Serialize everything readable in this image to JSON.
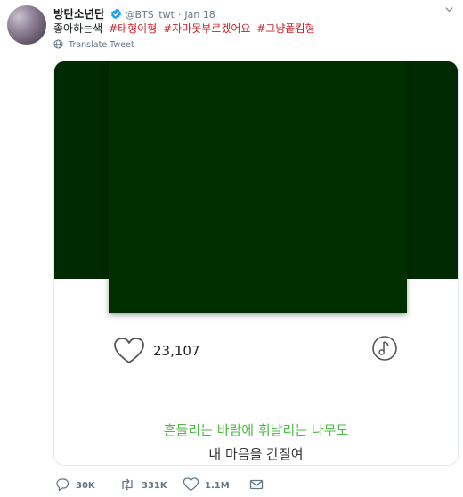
{
  "account": {
    "name": "방탄소년단",
    "handle": "@BTS_twt",
    "separator": "·",
    "date": "Jan 18"
  },
  "tweet": {
    "text": "좋아하는색",
    "hashtags": [
      "#태형이형",
      "#자마못부르겠어요",
      "#그냥퐅킴형"
    ]
  },
  "translate_label": "Translate Tweet",
  "card": {
    "likes": "23,107",
    "lyric_line_1": "흔들리는 바람에 휘날리는 나무도",
    "lyric_line_2": "내 마음을 간질여",
    "background_color": "#002a01",
    "art_color": "#002f00",
    "lyric_highlight_color": "#4cba45"
  },
  "actions": {
    "replies": "30K",
    "retweets": "331K",
    "likes": "1.1M"
  },
  "colors": {
    "hashtag": "#cc1f27",
    "verified": "#1da1f2",
    "muted": "#657786"
  }
}
